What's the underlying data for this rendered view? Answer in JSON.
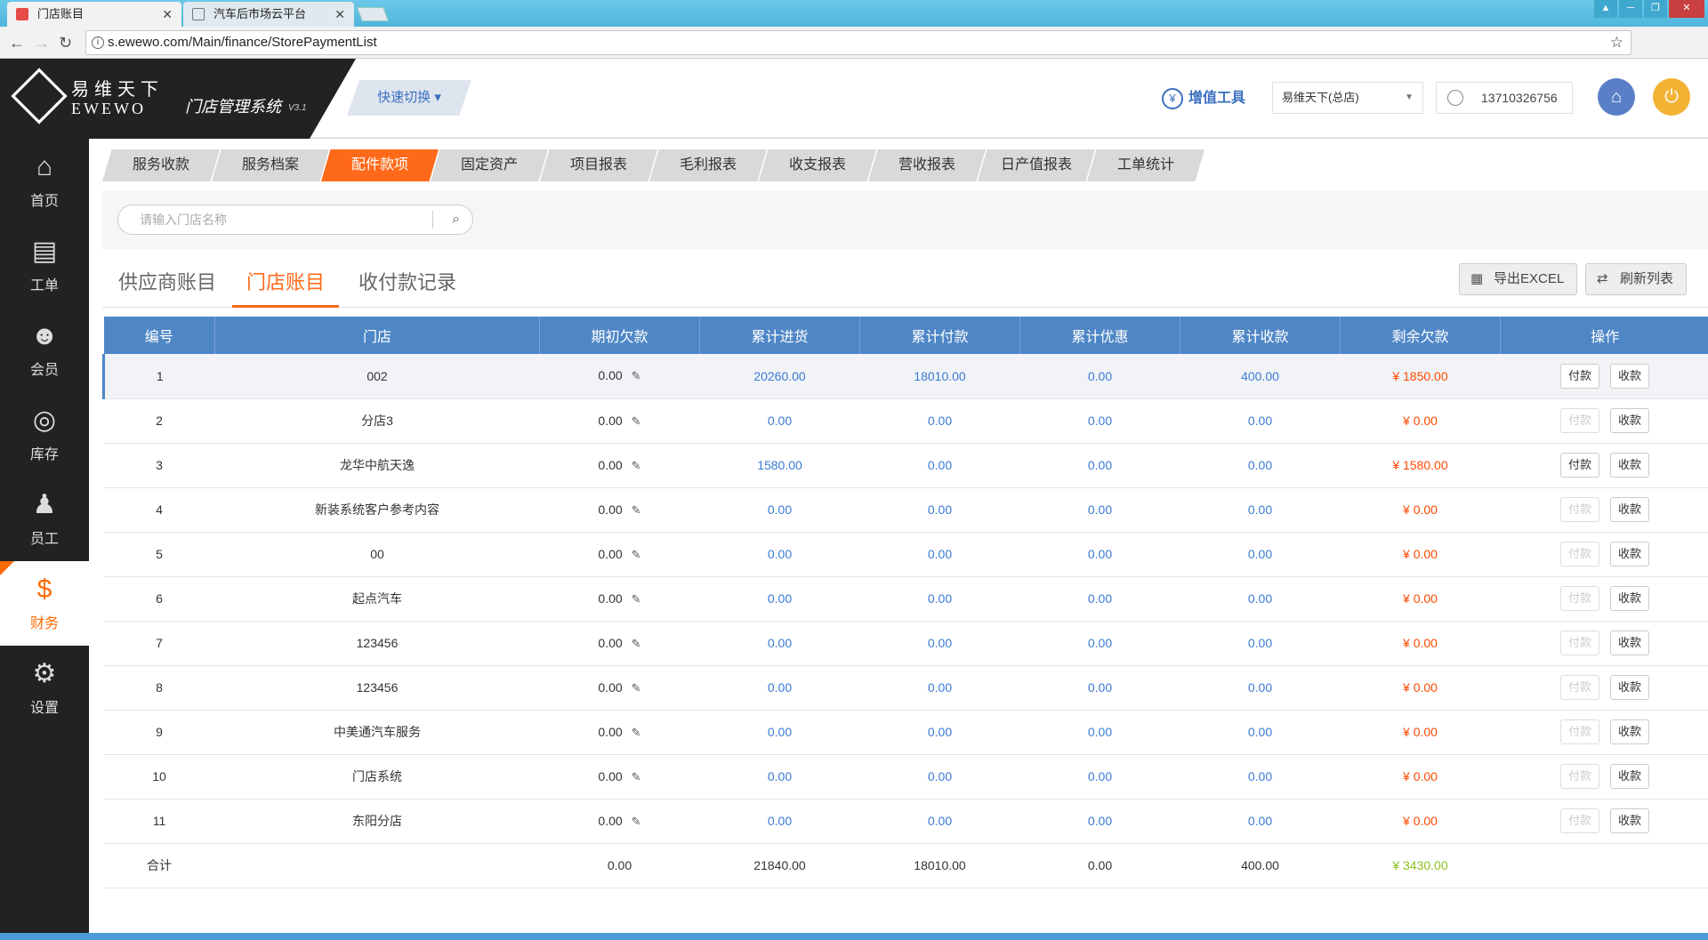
{
  "browser": {
    "tabs": [
      {
        "label": "门店账目",
        "active": true
      },
      {
        "label": "汽车后市场云平台",
        "active": false
      }
    ],
    "url": "s.ewewo.com/Main/finance/StorePaymentList"
  },
  "header": {
    "logo_cn": "易维天下",
    "logo_en": "EWEWO",
    "system_name": "门店管理系统",
    "version": "V3.1",
    "quick_switch": "快速切换",
    "value_tools": "增值工具",
    "store_select": "易维天下(总店)",
    "user_phone": "13710326756"
  },
  "sidebar": {
    "items": [
      {
        "label": "首页",
        "icon": "home-icon"
      },
      {
        "label": "工单",
        "icon": "work-order-icon"
      },
      {
        "label": "会员",
        "icon": "member-icon"
      },
      {
        "label": "库存",
        "icon": "inventory-icon"
      },
      {
        "label": "员工",
        "icon": "staff-icon"
      },
      {
        "label": "财务",
        "icon": "finance-icon",
        "active": true
      },
      {
        "label": "设置",
        "icon": "gear-icon"
      }
    ]
  },
  "module_tabs": [
    {
      "label": "服务收款"
    },
    {
      "label": "服务档案"
    },
    {
      "label": "配件款项",
      "active": true
    },
    {
      "label": "固定资产"
    },
    {
      "label": "项目报表"
    },
    {
      "label": "毛利报表"
    },
    {
      "label": "收支报表"
    },
    {
      "label": "营收报表"
    },
    {
      "label": "日产值报表"
    },
    {
      "label": "工单统计"
    }
  ],
  "search": {
    "placeholder": "请输入门店名称"
  },
  "sub_tabs": [
    {
      "label": "供应商账目"
    },
    {
      "label": "门店账目",
      "active": true
    },
    {
      "label": "收付款记录"
    }
  ],
  "toolbar": {
    "export_label": "导出EXCEL",
    "refresh_label": "刷新列表"
  },
  "table": {
    "headers": [
      "编号",
      "门店",
      "期初欠款",
      "累计进货",
      "累计付款",
      "累计优惠",
      "累计收款",
      "剩余欠款",
      "操作"
    ],
    "action_pay": "付款",
    "action_receive": "收款",
    "rows": [
      {
        "id": "1",
        "store": "002",
        "opening": "0.00",
        "purchase": "20260.00",
        "paid": "18010.00",
        "discount": "0.00",
        "received": "400.00",
        "remaining": "¥ 1850.00",
        "pay_enabled": true
      },
      {
        "id": "2",
        "store": "分店3",
        "opening": "0.00",
        "purchase": "0.00",
        "paid": "0.00",
        "discount": "0.00",
        "received": "0.00",
        "remaining": "¥ 0.00",
        "pay_enabled": false
      },
      {
        "id": "3",
        "store": "龙华中航天逸",
        "opening": "0.00",
        "purchase": "1580.00",
        "paid": "0.00",
        "discount": "0.00",
        "received": "0.00",
        "remaining": "¥ 1580.00",
        "pay_enabled": true
      },
      {
        "id": "4",
        "store": "新装系统客户参考内容",
        "opening": "0.00",
        "purchase": "0.00",
        "paid": "0.00",
        "discount": "0.00",
        "received": "0.00",
        "remaining": "¥ 0.00",
        "pay_enabled": false
      },
      {
        "id": "5",
        "store": "00",
        "opening": "0.00",
        "purchase": "0.00",
        "paid": "0.00",
        "discount": "0.00",
        "received": "0.00",
        "remaining": "¥ 0.00",
        "pay_enabled": false
      },
      {
        "id": "6",
        "store": "起点汽车",
        "opening": "0.00",
        "purchase": "0.00",
        "paid": "0.00",
        "discount": "0.00",
        "received": "0.00",
        "remaining": "¥ 0.00",
        "pay_enabled": false
      },
      {
        "id": "7",
        "store": "123456",
        "opening": "0.00",
        "purchase": "0.00",
        "paid": "0.00",
        "discount": "0.00",
        "received": "0.00",
        "remaining": "¥ 0.00",
        "pay_enabled": false
      },
      {
        "id": "8",
        "store": "123456",
        "opening": "0.00",
        "purchase": "0.00",
        "paid": "0.00",
        "discount": "0.00",
        "received": "0.00",
        "remaining": "¥ 0.00",
        "pay_enabled": false
      },
      {
        "id": "9",
        "store": "中美通汽车服务",
        "opening": "0.00",
        "purchase": "0.00",
        "paid": "0.00",
        "discount": "0.00",
        "received": "0.00",
        "remaining": "¥ 0.00",
        "pay_enabled": false
      },
      {
        "id": "10",
        "store": "门店系统",
        "opening": "0.00",
        "purchase": "0.00",
        "paid": "0.00",
        "discount": "0.00",
        "received": "0.00",
        "remaining": "¥ 0.00",
        "pay_enabled": false
      },
      {
        "id": "11",
        "store": "东阳分店",
        "opening": "0.00",
        "purchase": "0.00",
        "paid": "0.00",
        "discount": "0.00",
        "received": "0.00",
        "remaining": "¥ 0.00",
        "pay_enabled": false
      }
    ],
    "summary": {
      "label": "合计",
      "opening": "0.00",
      "purchase": "21840.00",
      "paid": "18010.00",
      "discount": "0.00",
      "received": "400.00",
      "remaining": "¥ 3430.00"
    }
  },
  "colors": {
    "accent": "#ff6a1a",
    "header_blue": "#4f86c6",
    "value_blue": "#3a7bd5",
    "debt_red": "#ff4a00",
    "sum_green": "#8dc21f"
  }
}
